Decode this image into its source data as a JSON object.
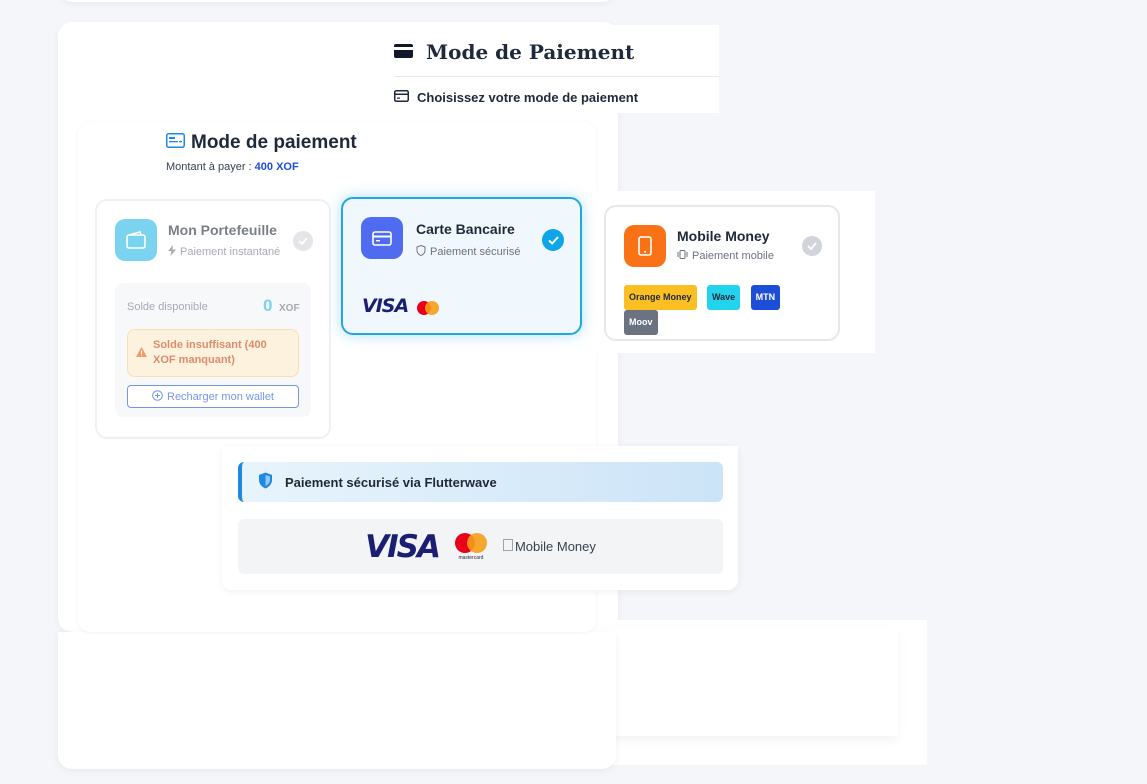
{
  "header": {
    "title": "Mode de Paiement",
    "subtitle": "Choisissez votre mode de paiement"
  },
  "panel": {
    "title": "Mode de paiement",
    "amount_label": "Montant à payer :",
    "amount_value": "400 XOF"
  },
  "wallet": {
    "title": "Mon Portefeuille",
    "subtitle": "Paiement instantané",
    "balance_label": "Solde disponible",
    "balance_value": "0",
    "balance_currency": "XOF",
    "warning": "Solde insuffisant (400 XOF manquant)",
    "reload_label": "Recharger mon wallet",
    "selected": false
  },
  "bank_card": {
    "title": "Carte Bancaire",
    "subtitle": "Paiement sécurisé",
    "brand_visa": "VISA",
    "selected": true
  },
  "mobile_money": {
    "title": "Mobile Money",
    "subtitle": "Paiement mobile",
    "operators": [
      {
        "label": "Orange Money",
        "bg": "#fbbf24",
        "fg": "#1f2937"
      },
      {
        "label": "Wave",
        "bg": "#22d3ee",
        "fg": "#1f2937"
      },
      {
        "label": "MTN",
        "bg": "#1d4ed8",
        "fg": "#ffffff"
      },
      {
        "label": "Moov",
        "bg": "#6b7280",
        "fg": "#ffffff"
      }
    ],
    "selected": false
  },
  "secure": {
    "banner_text": "Paiement sécurisé via Flutterwave",
    "visa_text": "VISA",
    "mastercard_text": "mastercard",
    "mobile_money_alt": "Mobile Money"
  },
  "colors": {
    "accent": "#22a7e0",
    "primary_blue": "#1d4ed8",
    "wallet_icon_bg": "#22b8e6",
    "bank_icon_bg": "#4f6cf0",
    "mm_icon_bg": "#f97316"
  },
  "icons": {
    "header": "credit-card-icon",
    "wallet": "wallet-icon",
    "bank": "credit-card-icon",
    "mobile": "smartphone-icon",
    "secure": "shield-icon"
  }
}
